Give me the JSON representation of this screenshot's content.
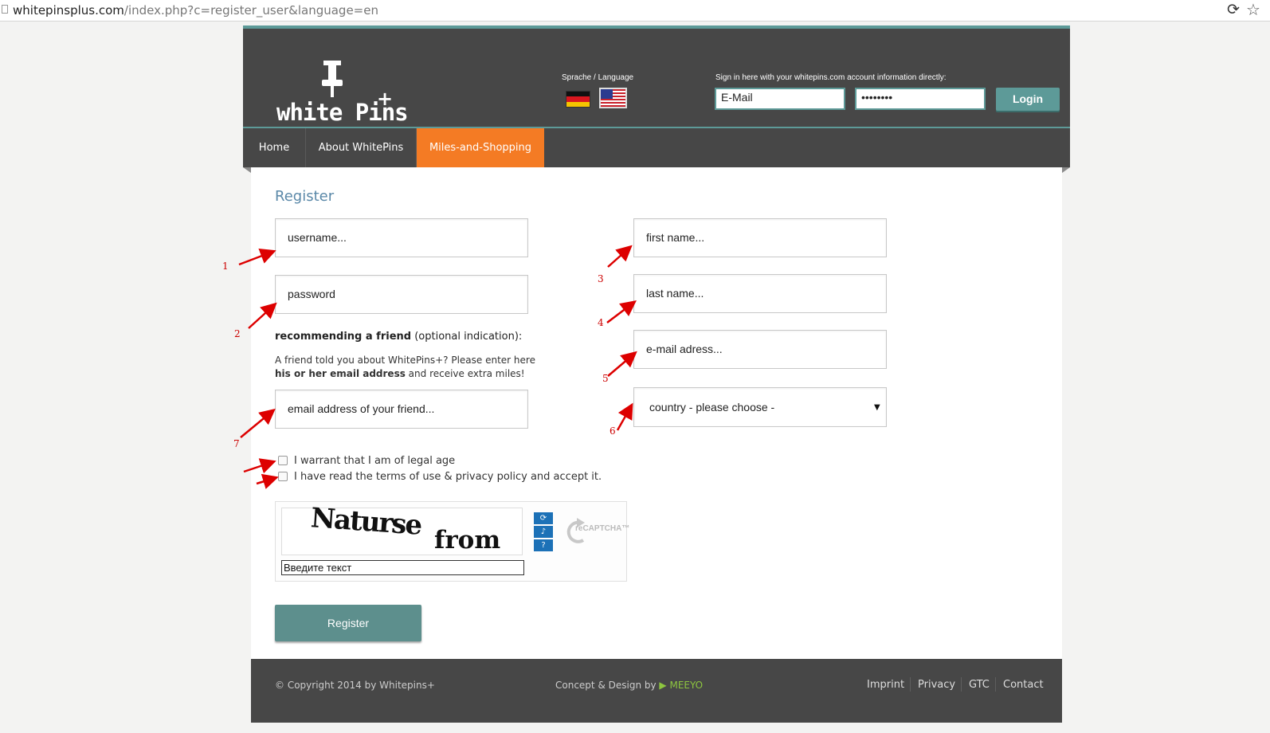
{
  "browser": {
    "url_host": "whitepinsplus.com",
    "url_path": "/index.php?c=register_user&language=en"
  },
  "header": {
    "logo_word1": "white",
    "logo_word2": "Pins",
    "logo_plus": "+",
    "language_label": "Sprache / Language",
    "signin_label": "Sign in here with your whitepins.com account information directly:",
    "email_value": "E-Mail",
    "password_value": "••••••••",
    "login_label": "Login"
  },
  "nav": {
    "items": [
      {
        "label": "Home"
      },
      {
        "label": "About WhitePins"
      },
      {
        "label": "Miles-and-Shopping",
        "active": true
      }
    ]
  },
  "form": {
    "title": "Register",
    "username": "username...",
    "password": "password",
    "first_name": "first name...",
    "last_name": "last name...",
    "email": "e-mail adress...",
    "country": "country - please choose -",
    "recommend_bold": "recommending a friend",
    "recommend_rest": " (optional indication):",
    "recommend_desc1": "A friend told you about WhitePins+? Please enter here",
    "recommend_desc2_bold": "his or her email address",
    "recommend_desc2_rest": " and receive extra miles!",
    "friend_email": "email address of your friend...",
    "checkbox_age": "I warrant that I am of legal age",
    "checkbox_terms": "I have read the terms of use & privacy policy and accept it.",
    "captcha_word1": "Naturse",
    "captcha_word2": "from",
    "captcha_input": "Введите текст",
    "recaptcha_brand": "reCAPTCHA™",
    "register_label": "Register"
  },
  "footer": {
    "copyright": "© Copyright 2014 by Whitepins+",
    "concept_prefix": "Concept & Design by ",
    "concept_arrow": "▶",
    "concept_brand": "MEEYO",
    "links": [
      "Imprint",
      "Privacy",
      "GTC",
      "Contact"
    ]
  },
  "annotations": [
    "1",
    "2",
    "3",
    "4",
    "5",
    "6",
    "7"
  ],
  "colors": {
    "header_bg": "#474747",
    "accent_teal": "#5d9a98",
    "nav_active": "#f47b24",
    "title_blue": "#5a88a8",
    "annotation_red": "#c00000",
    "brand_green": "#8ec63f"
  }
}
